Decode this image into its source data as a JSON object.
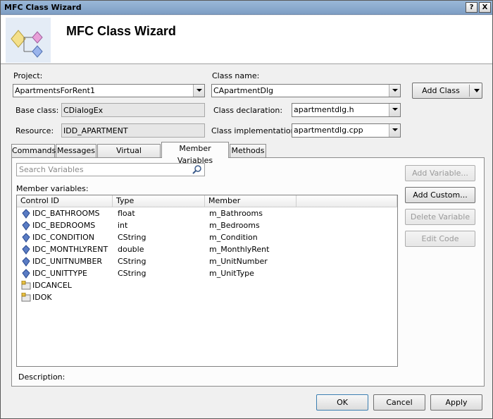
{
  "window": {
    "title": "MFC Class Wizard",
    "help_label": "?",
    "close_label": "X"
  },
  "header": {
    "title": "MFC Class Wizard"
  },
  "project": {
    "label": "Project:",
    "value": "ApartmentsForRent1"
  },
  "class_name": {
    "label": "Class name:",
    "value": "CApartmentDlg"
  },
  "add_class": {
    "label": "Add Class"
  },
  "base_class": {
    "label": "Base class:",
    "value": "CDialogEx"
  },
  "resource": {
    "label": "Resource:",
    "value": "IDD_APARTMENT"
  },
  "class_declaration": {
    "label": "Class declaration:",
    "value": "apartmentdlg.h"
  },
  "class_implementation": {
    "label": "Class implementation:",
    "value": "apartmentdlg.cpp"
  },
  "tabs": [
    {
      "label": "Commands"
    },
    {
      "label": "Messages"
    },
    {
      "label": "Virtual Functions"
    },
    {
      "label": "Member Variables"
    },
    {
      "label": "Methods"
    }
  ],
  "search": {
    "placeholder": "Search Variables"
  },
  "member_variables": {
    "label": "Member variables:",
    "columns": [
      "Control ID",
      "Type",
      "Member"
    ],
    "rows": [
      {
        "id": "IDC_BATHROOMS",
        "type": "float",
        "member": "m_Bathrooms",
        "icon": "control-icon"
      },
      {
        "id": "IDC_BEDROOMS",
        "type": "int",
        "member": "m_Bedrooms",
        "icon": "control-icon"
      },
      {
        "id": "IDC_CONDITION",
        "type": "CString",
        "member": "m_Condition",
        "icon": "control-icon"
      },
      {
        "id": "IDC_MONTHLYRENT",
        "type": "double",
        "member": "m_MonthlyRent",
        "icon": "control-icon"
      },
      {
        "id": "IDC_UNITNUMBER",
        "type": "CString",
        "member": "m_UnitNumber",
        "icon": "control-icon"
      },
      {
        "id": "IDC_UNITTYPE",
        "type": "CString",
        "member": "m_UnitType",
        "icon": "control-icon"
      },
      {
        "id": "IDCANCEL",
        "type": "",
        "member": "",
        "icon": "button-control-icon"
      },
      {
        "id": "IDOK",
        "type": "",
        "member": "",
        "icon": "button-control-icon"
      }
    ]
  },
  "side_buttons": {
    "add_variable": "Add Variable...",
    "add_custom": "Add Custom...",
    "delete_variable": "Delete Variable",
    "edit_code": "Edit Code"
  },
  "description": {
    "label": "Description:"
  },
  "footer": {
    "ok": "OK",
    "cancel": "Cancel",
    "apply": "Apply"
  }
}
